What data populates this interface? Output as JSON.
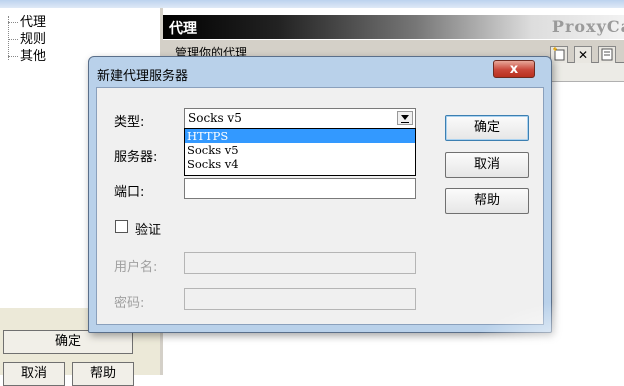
{
  "tree": {
    "items": [
      {
        "label": "代理"
      },
      {
        "label": "规则"
      },
      {
        "label": "其他"
      }
    ]
  },
  "banner": {
    "title": "代理",
    "brand_partial": "ProxyCa"
  },
  "subheader": {
    "text": "管理你的代理"
  },
  "toolbar": {
    "icons": [
      "new-proxy-icon",
      "delete-icon",
      "properties-icon"
    ],
    "delete_glyph": "✕"
  },
  "main_buttons": {
    "ok_label": "确定",
    "cancel_label": "取消",
    "help_label": "帮助"
  },
  "dialog": {
    "title": "新建代理服务器",
    "close_glyph": "x",
    "type": {
      "label": "类型:",
      "selected": "Socks v5",
      "options": [
        "HTTPS",
        "Socks v5",
        "Socks v4"
      ],
      "highlighted": "HTTPS"
    },
    "server": {
      "label": "服务器:",
      "value": ""
    },
    "port": {
      "label": "端口:",
      "value": ""
    },
    "auth": {
      "label": "验证",
      "checked": false
    },
    "username": {
      "label": "用户名:",
      "value": ""
    },
    "password": {
      "label": "密码:",
      "value": ""
    },
    "buttons": {
      "ok_label": "确定",
      "cancel_label": "取消",
      "help_label": "帮助"
    }
  },
  "colors": {
    "dialog_frame": "#b9d1ea",
    "selection": "#3399ff",
    "close_button": "#c9473a"
  }
}
